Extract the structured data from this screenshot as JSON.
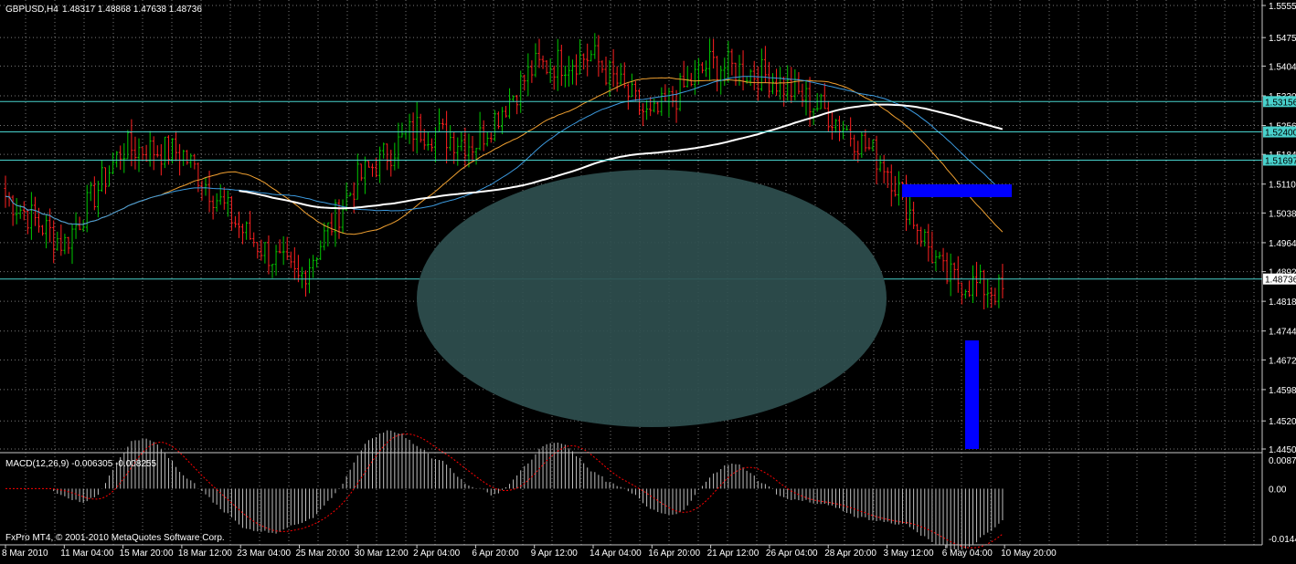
{
  "symbol_header": {
    "symbol": "GBPUSD,H4",
    "ohlc": "1.48317 1.48868 1.47638 1.48736"
  },
  "macd_header": {
    "label": "MACD(12,26,9) -0.006305 -0.008255"
  },
  "copyright": "FxPro MT4, © 2001-2010 MetaQuotes Software Corp.",
  "price_axis": [
    "1.55550",
    "1.54750",
    "1.54040",
    "1.53300",
    "1.52560",
    "1.51840",
    "1.51100",
    "1.50380",
    "1.49640",
    "1.48920",
    "1.48180",
    "1.47440",
    "1.46720",
    "1.45980",
    "1.45200",
    "1.44500"
  ],
  "macd_axis": [
    "0.00875",
    "0.00",
    "-0.01446"
  ],
  "price_tags": [
    {
      "text": "1.53156",
      "price": 1.53156,
      "color": "#48d1cc"
    },
    {
      "text": "1.52400",
      "price": 1.524,
      "color": "#48d1cc"
    },
    {
      "text": "1.51697",
      "price": 1.51697,
      "color": "#48d1cc"
    },
    {
      "text": "1.48736",
      "price": 1.48736,
      "color": "#ffffff"
    }
  ],
  "time_axis": [
    "8 Mar 2010",
    "11 Mar 04:00",
    "15 Mar 20:00",
    "18 Mar 12:00",
    "23 Mar 04:00",
    "25 Mar 20:00",
    "30 Mar 12:00",
    "2 Apr 04:00",
    "6 Apr 20:00",
    "9 Apr 12:00",
    "14 Apr 04:00",
    "16 Apr 20:00",
    "21 Apr 12:00",
    "26 Apr 04:00",
    "28 Apr 20:00",
    "3 May 12:00",
    "6 May 04:00",
    "10 May 20:00"
  ],
  "colors": {
    "background": "#000000",
    "grid": "#c8c8c8",
    "bull": "#00c800",
    "bear": "#ff2020",
    "ma_slow": "#ffffff",
    "ma_mid": "#3c9be0",
    "ma_fast": "#f0a030",
    "horizontal_lines": "#48d1cc",
    "ellipse": "#2f4f4f",
    "rectangles": "#0000ff",
    "macd_hist": "#c0c0c0",
    "macd_signal": "#ff0000"
  },
  "chart_data": {
    "type": "candlestick",
    "symbol": "GBPUSD",
    "timeframe": "H4",
    "ylim": [
      1.445,
      1.5555
    ],
    "macd_ylim": [
      -0.01446,
      0.00875
    ],
    "key_points": [
      {
        "t": "8 Mar 2010",
        "price": 1.508
      },
      {
        "t": "11 Mar 04:00",
        "price": 1.496
      },
      {
        "t": "15 Mar 20:00",
        "price": 1.52
      },
      {
        "t": "18 Mar 12:00",
        "price": 1.519
      },
      {
        "t": "23 Mar 04:00",
        "price": 1.5
      },
      {
        "t": "25 Mar 20:00",
        "price": 1.487
      },
      {
        "t": "30 Mar 12:00",
        "price": 1.512
      },
      {
        "t": "2 Apr 04:00",
        "price": 1.525
      },
      {
        "t": "6 Apr 20:00",
        "price": 1.521
      },
      {
        "t": "9 Apr 12:00",
        "price": 1.54
      },
      {
        "t": "14 Apr 04:00",
        "price": 1.543
      },
      {
        "t": "16 Apr 20:00",
        "price": 1.527
      },
      {
        "t": "21 Apr 12:00",
        "price": 1.541
      },
      {
        "t": "26 Apr 04:00",
        "price": 1.538
      },
      {
        "t": "28 Apr 20:00",
        "price": 1.529
      },
      {
        "t": "3 May 12:00",
        "price": 1.516
      },
      {
        "t": "6 May 04:00",
        "price": 1.488
      },
      {
        "t": "10 May 20:00",
        "price": 1.484
      }
    ],
    "horizontal_lines": [
      1.53156,
      1.524,
      1.51697,
      1.48736
    ]
  }
}
